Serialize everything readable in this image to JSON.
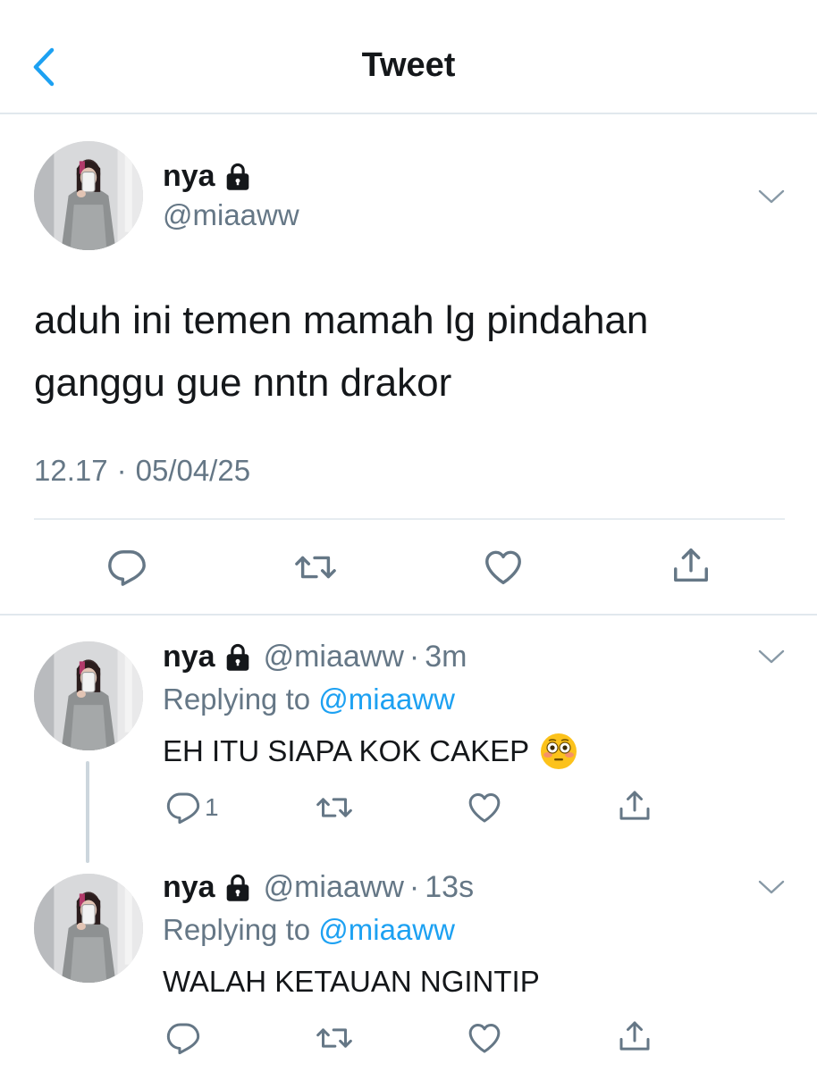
{
  "header": {
    "title": "Tweet",
    "back_icon": "chevron-left-icon"
  },
  "colors": {
    "accent": "#1da1f2",
    "secondary_text": "#657786",
    "divider": "#e1e8ed"
  },
  "main_tweet": {
    "name": "nya",
    "handle": "@miaaww",
    "text": "aduh ini temen mamah lg pindahan ganggu gue nntn drakor",
    "time": "12.17",
    "sep": "·",
    "date": "05/04/25",
    "actions": [
      "reply-icon",
      "retweet-icon",
      "like-icon",
      "share-icon"
    ]
  },
  "replies": [
    {
      "name": "nya",
      "handle": "@miaaww",
      "sep": "·",
      "time": "3m",
      "replying_prefix": "Replying to",
      "replying_to": "@miaaww",
      "text": "EH ITU SIAPA KOK CAKEP",
      "emoji": "flushed-face-emoji",
      "reply_count": "1"
    },
    {
      "name": "nya",
      "handle": "@miaaww",
      "sep": "·",
      "time": "13s",
      "replying_prefix": "Replying to",
      "replying_to": "@miaaww",
      "text": "WALAH KETAUAN NGINTIP"
    }
  ]
}
